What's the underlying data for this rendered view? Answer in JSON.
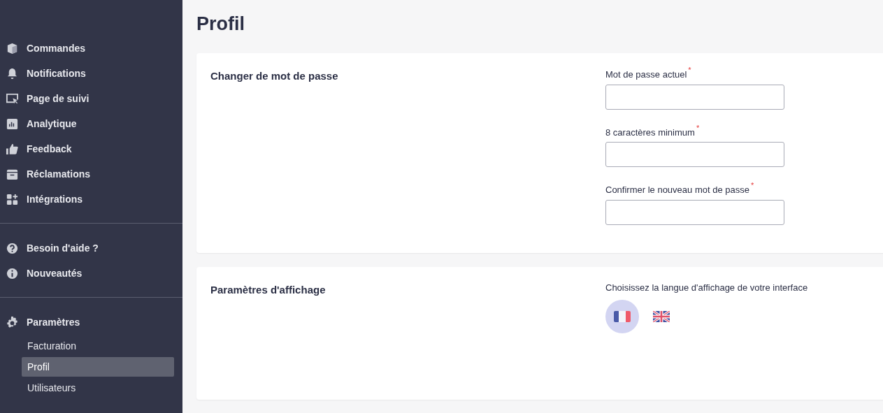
{
  "sidebar": {
    "groups": [
      {
        "items": [
          {
            "label": "Commandes"
          },
          {
            "label": "Notifications"
          },
          {
            "label": "Page de suivi"
          },
          {
            "label": "Analytique"
          },
          {
            "label": "Feedback"
          },
          {
            "label": "Réclamations"
          },
          {
            "label": "Intégrations"
          }
        ]
      },
      {
        "items": [
          {
            "label": "Besoin d'aide ?"
          },
          {
            "label": "Nouveautés"
          }
        ]
      },
      {
        "items": [
          {
            "label": "Paramètres",
            "children": [
              {
                "label": "Facturation",
                "selected": false
              },
              {
                "label": "Profil",
                "selected": true
              },
              {
                "label": "Utilisateurs",
                "selected": false
              }
            ]
          }
        ]
      }
    ]
  },
  "page_title": "Profil",
  "sections": [
    {
      "title": "Changer de mot de passe",
      "kind": "password",
      "fields": [
        {
          "label": "Mot de passe actuel",
          "required_mark": "*"
        },
        {
          "label": "8 caractères minimum",
          "required_mark": "*"
        },
        {
          "label": "Confirmer le nouveau mot de passe",
          "required_mark": "*"
        }
      ]
    },
    {
      "title": "Paramètres d'affichage",
      "kind": "language",
      "prompt": "Choisissez la langue d'affichage de votre interface",
      "languages": [
        {
          "kind": "france",
          "selected": true
        },
        {
          "kind": "uk",
          "selected": false
        }
      ]
    }
  ]
}
